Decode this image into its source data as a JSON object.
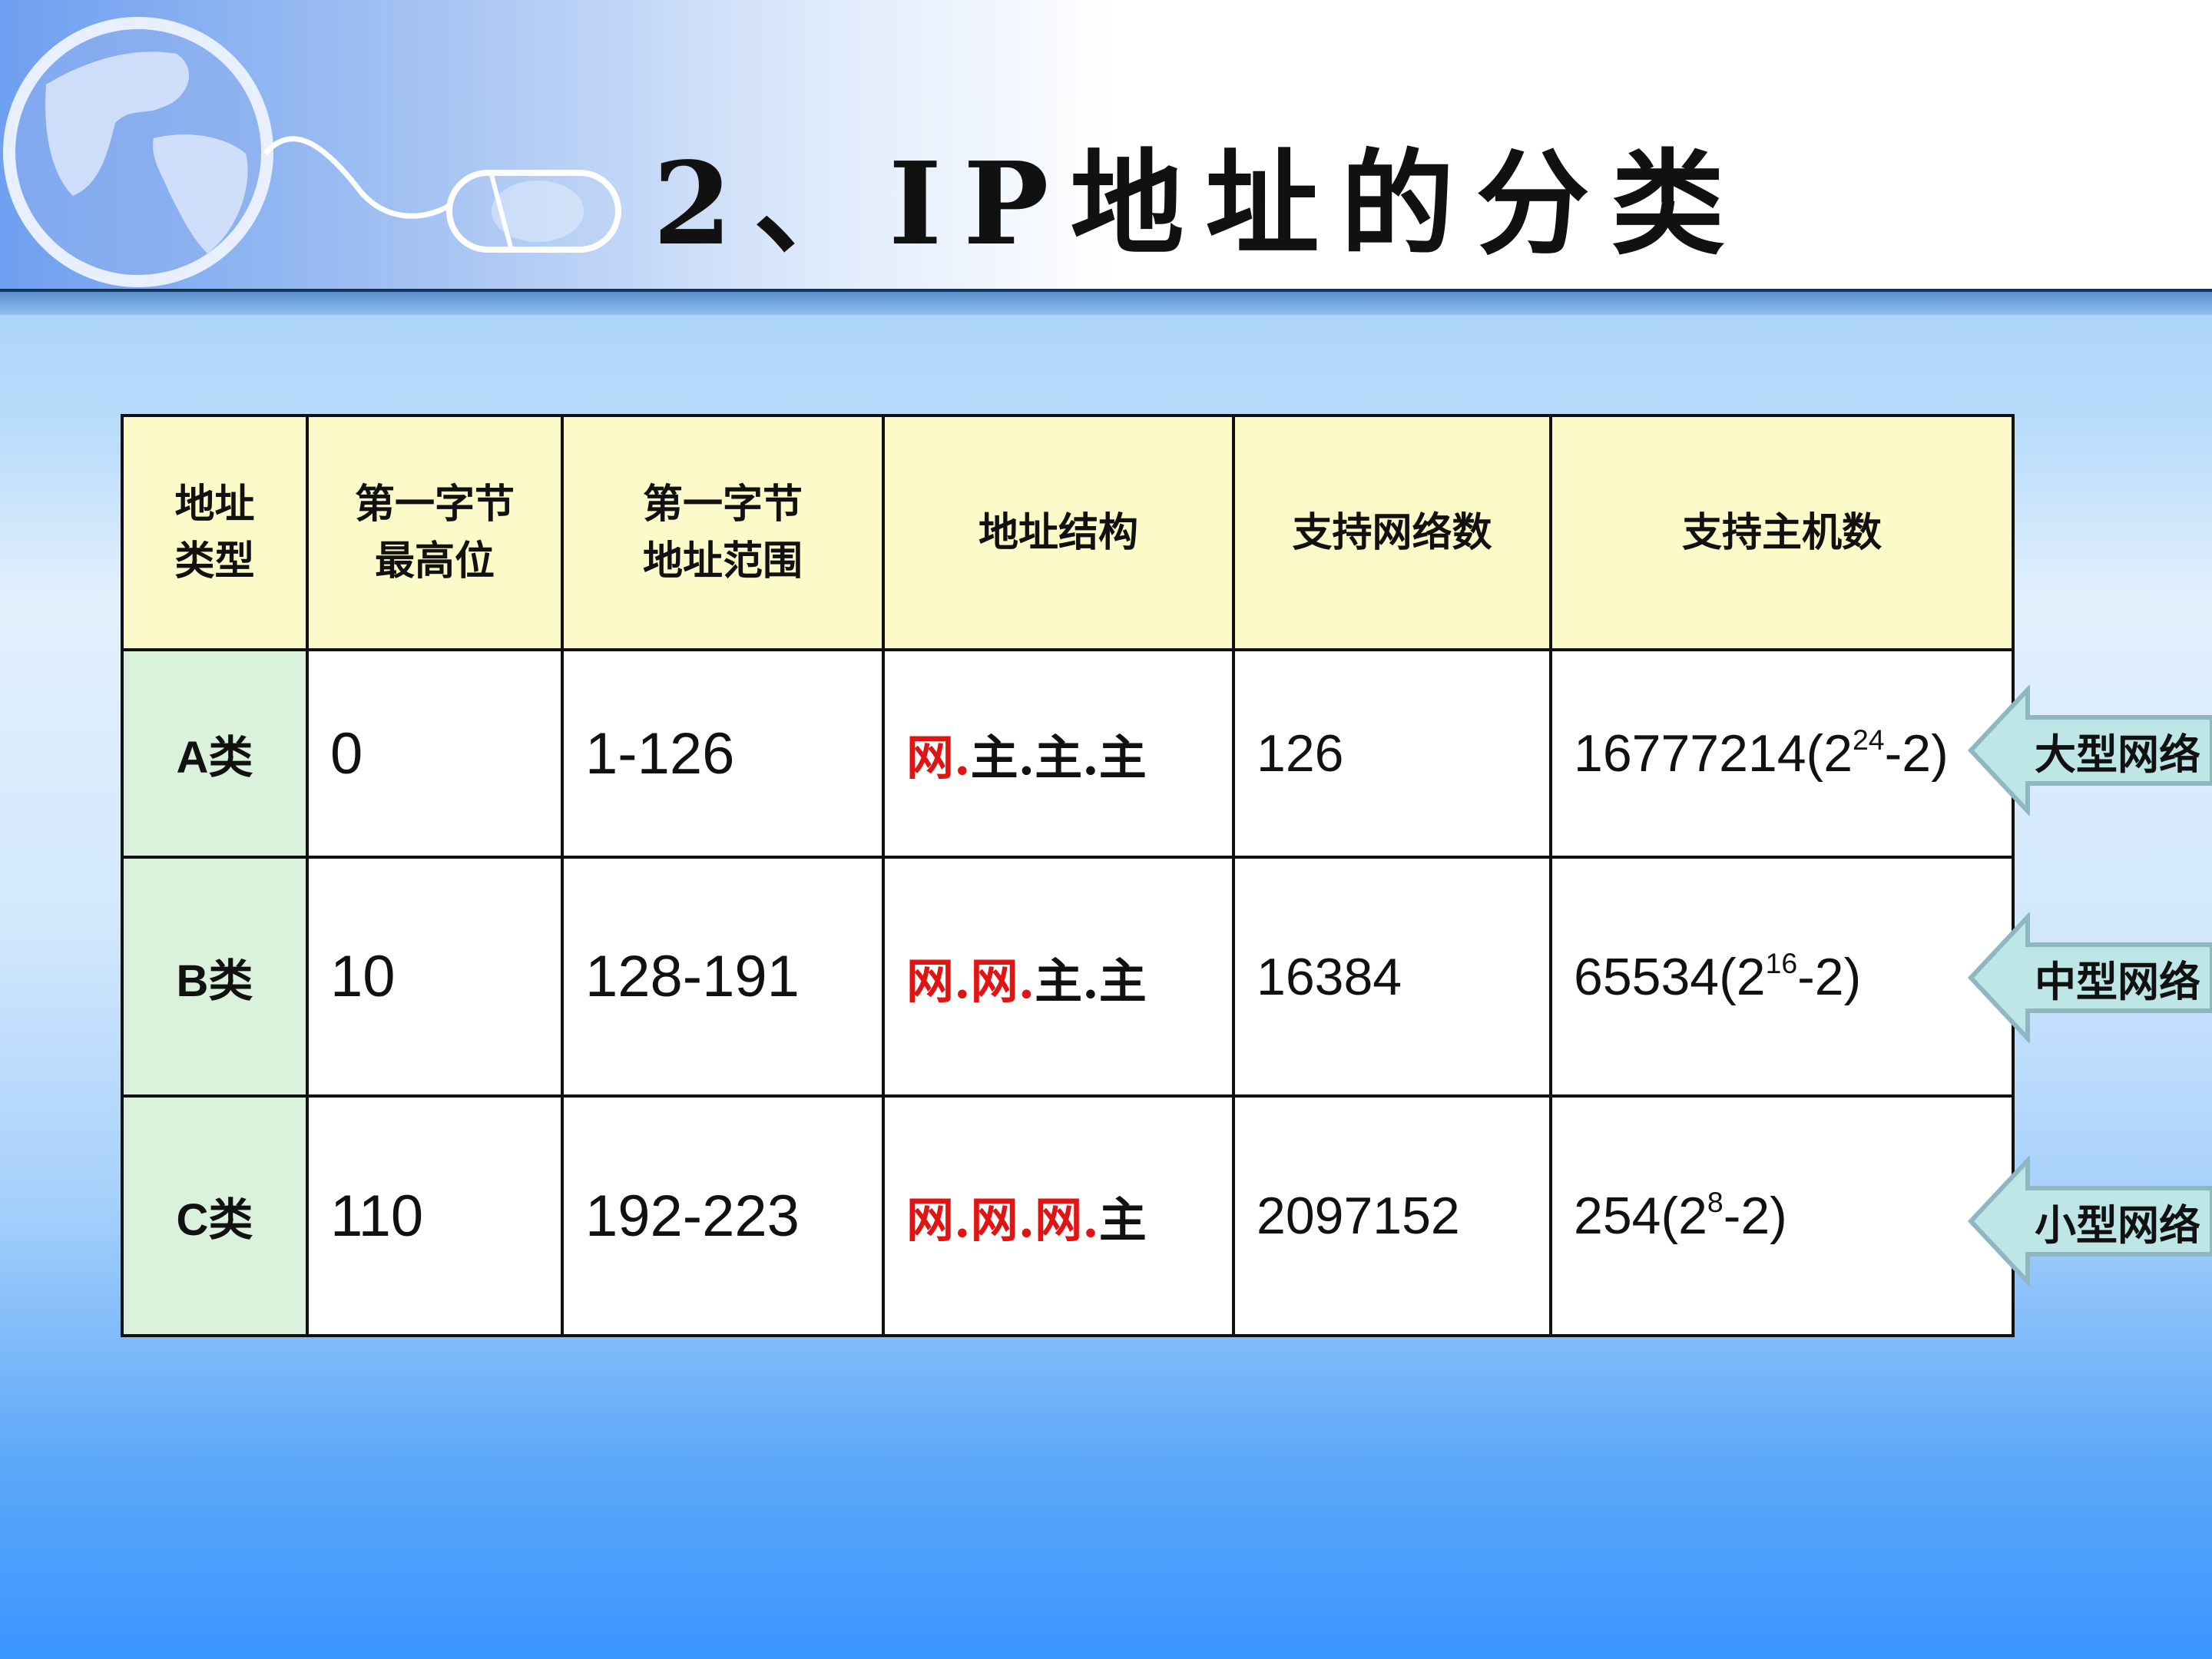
{
  "slide": {
    "title": "2、IP地址的分类"
  },
  "table": {
    "headers": [
      [
        "地址",
        "类型"
      ],
      [
        "第一字节",
        "最高位"
      ],
      [
        "第一字节",
        "地址范围"
      ],
      [
        "地址结构"
      ],
      [
        "支持网络数"
      ],
      [
        "支持主机数"
      ]
    ],
    "rows": [
      {
        "class": "A类",
        "high_bits": "0",
        "range": "1-126",
        "structure": [
          {
            "text": "网.",
            "kind": "net"
          },
          {
            "text": "主.主.主",
            "kind": "host"
          }
        ],
        "networks": "126",
        "hosts": {
          "base": "16777214(2",
          "exp": "24",
          "tail": "-2)"
        }
      },
      {
        "class": "B类",
        "high_bits": "10",
        "range": "128-191",
        "structure": [
          {
            "text": "网.网.",
            "kind": "net"
          },
          {
            "text": "主.主",
            "kind": "host"
          }
        ],
        "networks": "16384",
        "hosts": {
          "base": "65534(2",
          "exp": "16",
          "tail": "-2)"
        }
      },
      {
        "class": "C类",
        "high_bits": "110",
        "range": "192-223",
        "structure": [
          {
            "text": "网.网.网.",
            "kind": "net"
          },
          {
            "text": "主",
            "kind": "host"
          }
        ],
        "networks": "2097152",
        "hosts": {
          "base": "254(2",
          "exp": "8",
          "tail": "-2)"
        }
      }
    ]
  },
  "callouts": [
    {
      "label": "大型网络"
    },
    {
      "label": "中型网络"
    },
    {
      "label": "小型网络"
    }
  ],
  "colors": {
    "network_part": "#e11414",
    "header_fill": "#fdfac9",
    "class_fill": "#daf2dc",
    "callout_fill": "#bfe6e6"
  },
  "icons": [
    "globe-icon",
    "computer-mouse-icon"
  ]
}
